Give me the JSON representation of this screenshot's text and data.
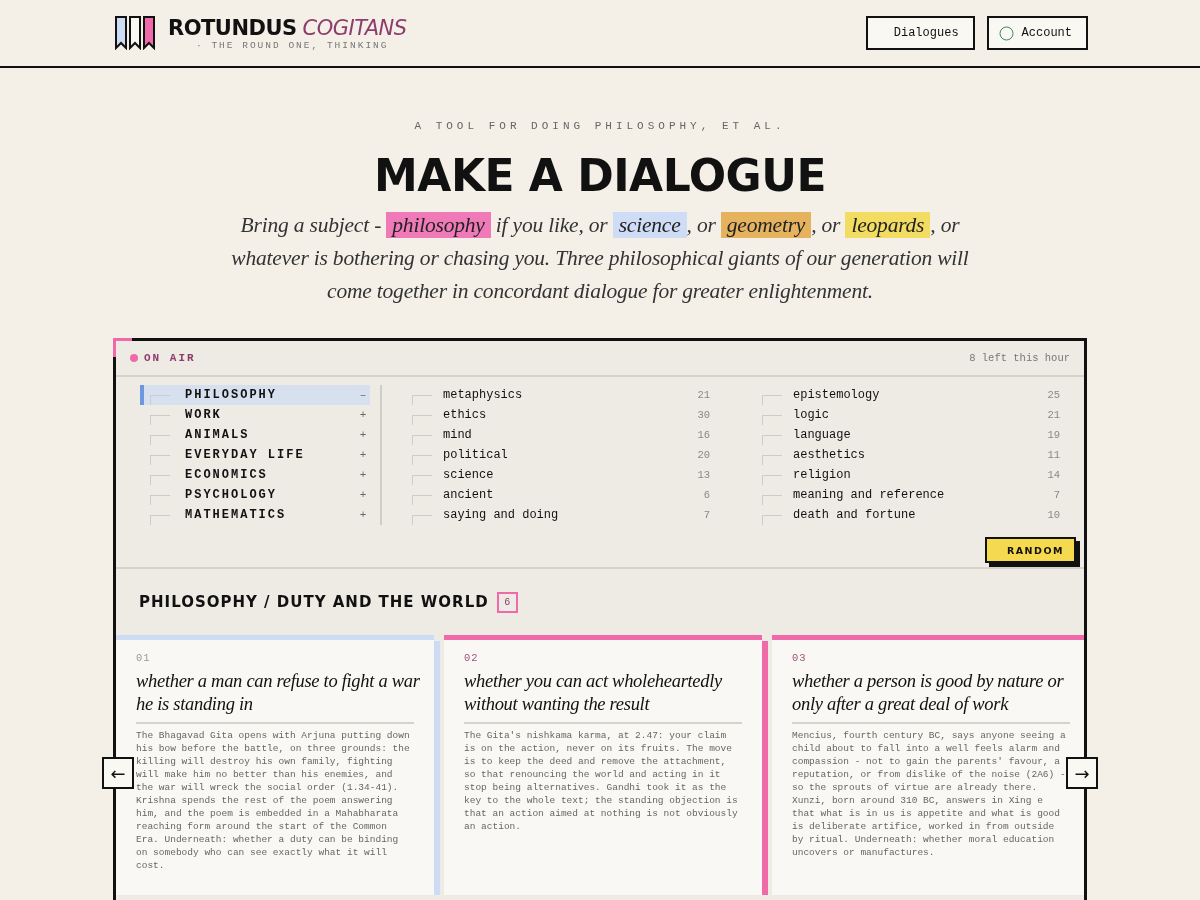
{
  "header": {
    "brand_main": "ROTUNDUS",
    "brand_accent": "COGITANS",
    "tagline": "· THE ROUND ONE, THINKING",
    "nav": [
      {
        "label": "Dialogues",
        "kind": "plain"
      },
      {
        "label": "Account",
        "kind": "account"
      }
    ]
  },
  "hero": {
    "eyebrow": "A TOOL FOR DOING PHILOSOPHY, ET AL.",
    "title": "MAKE A DIALOGUE",
    "intro": [
      {
        "text": "Bring a subject - "
      },
      {
        "text": "philosophy",
        "color": "#f07ab8"
      },
      {
        "text": " if you like, or "
      },
      {
        "text": "science",
        "color": "#cfdcf5"
      },
      {
        "text": ", or "
      },
      {
        "text": "geometry",
        "color": "#e5b35e"
      },
      {
        "text": ", or "
      },
      {
        "text": "leopards",
        "color": "#f3dc62"
      },
      {
        "text": ", or whatever is bothering or chasing you. Three philosophical giants of our generation will come together in concordant dialogue for greater enlightenment."
      }
    ]
  },
  "panel": {
    "status": "ON AIR",
    "remaining": "8 left this hour",
    "categories": [
      {
        "label": "PHILOSOPHY",
        "toggle": "–",
        "selected": true
      },
      {
        "label": "WORK",
        "toggle": "+",
        "selected": false
      },
      {
        "label": "ANIMALS",
        "toggle": "+",
        "selected": false
      },
      {
        "label": "EVERYDAY LIFE",
        "toggle": "+",
        "selected": false
      },
      {
        "label": "ECONOMICS",
        "toggle": "+",
        "selected": false
      },
      {
        "label": "PSYCHOLOGY",
        "toggle": "+",
        "selected": false
      },
      {
        "label": "MATHEMATICS",
        "toggle": "+",
        "selected": false
      }
    ],
    "subtopic_columns": [
      [
        {
          "label": "metaphysics",
          "count": "21"
        },
        {
          "label": "ethics",
          "count": "30"
        },
        {
          "label": "mind",
          "count": "16"
        },
        {
          "label": "political",
          "count": "20"
        },
        {
          "label": "science",
          "count": "13"
        },
        {
          "label": "ancient",
          "count": "6"
        },
        {
          "label": "saying and doing",
          "count": "7"
        }
      ],
      [
        {
          "label": "epistemology",
          "count": "25"
        },
        {
          "label": "logic",
          "count": "21"
        },
        {
          "label": "language",
          "count": "19"
        },
        {
          "label": "aesthetics",
          "count": "11"
        },
        {
          "label": "religion",
          "count": "14"
        },
        {
          "label": "meaning and reference",
          "count": "7"
        },
        {
          "label": "death and fortune",
          "count": "10"
        }
      ]
    ],
    "random_button": "RANDOM",
    "section_title": "PHILOSOPHY / DUTY AND THE WORLD",
    "section_count": "6",
    "prev_button": "←",
    "next_button": "→",
    "cards": [
      {
        "number": "01",
        "color": "#cddcf5",
        "title": "whether a man can refuse to fight a war he is standing in",
        "body": "The Bhagavad Gita opens with Arjuna putting down his bow before the battle, on three grounds: the killing will destroy his own family, fighting will make him no better than his enemies, and the war will wreck the social order (1.34-41). Krishna spends the rest of the poem answering him, and the poem is embedded in a Mahabharata reaching form around the start of the Common Era. Underneath: whether a duty can be binding on somebody who can see exactly what it will cost."
      },
      {
        "number": "02",
        "color": "#f06aaa",
        "title": "whether you can act wholeheartedly without wanting the result",
        "body": "The Gita's nishkama karma, at 2.47: your claim is on the action, never on its fruits. The move is to keep the deed and remove the attachment, so that renouncing the world and acting in it stop being alternatives. Gandhi took it as the key to the whole text; the standing objection is that an action aimed at nothing is not obviously an action."
      },
      {
        "number": "03",
        "color": "#f06aaa",
        "title": "whether a person is good by nature or only after a great deal of work",
        "body": "Mencius, fourth century BC, says anyone seeing a child about to fall into a well feels alarm and compassion - not to gain the parents' favour, a reputation, or from dislike of the noise (2A6) - so the sprouts of virtue are already there. Xunzi, born around 310 BC, answers in Xing e that what is in us is appetite and what is good is deliberate artifice, worked in from outside by ritual. Underneath: whether moral education uncovers or manufactures."
      }
    ]
  }
}
